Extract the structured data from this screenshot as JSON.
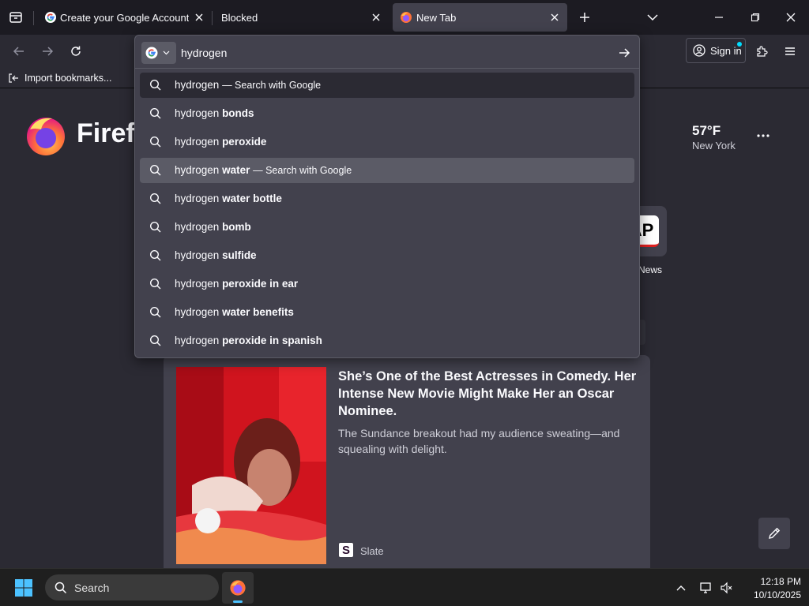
{
  "tabs": [
    {
      "label": "Create your Google Account",
      "icon": "google-icon"
    },
    {
      "label": "Blocked",
      "icon": ""
    },
    {
      "label": "New Tab",
      "icon": "firefox-icon"
    }
  ],
  "toolbar": {
    "sign_in": "Sign in",
    "import_bookmarks": "Import bookmarks..."
  },
  "urlbar": {
    "value": "hydrogen ",
    "engine_icon": "google-icon"
  },
  "suggestions": [
    {
      "base": "hydrogen",
      "bold": "",
      "hint": "— Search with Google"
    },
    {
      "base": "hydrogen",
      "bold": "bonds",
      "hint": ""
    },
    {
      "base": "hydrogen",
      "bold": "peroxide",
      "hint": ""
    },
    {
      "base": "hydrogen",
      "bold": "water",
      "hint": "— Search with Google"
    },
    {
      "base": "hydrogen",
      "bold": "water bottle",
      "hint": ""
    },
    {
      "base": "hydrogen",
      "bold": "bomb",
      "hint": ""
    },
    {
      "base": "hydrogen",
      "bold": "sulfide",
      "hint": ""
    },
    {
      "base": "hydrogen",
      "bold": "peroxide in ear",
      "hint": ""
    },
    {
      "base": "hydrogen",
      "bold": "water benefits",
      "hint": ""
    },
    {
      "base": "hydrogen",
      "bold": "peroxide in spanish",
      "hint": ""
    }
  ],
  "newtab": {
    "brand": "Firefox",
    "weather_temp": "57°F",
    "weather_city": "New York",
    "shortcut_label": "News",
    "shortcut_tile_text": "AP"
  },
  "story": {
    "title": "She’s One of the Best Actresses in Comedy. Her Intense New Movie Might Make Her an Oscar Nominee.",
    "excerpt": "The Sundance breakout had my audience sweating—and squealing with delight.",
    "source": "Slate",
    "source_logo_letter": "S"
  },
  "taskbar": {
    "search_label": "Search",
    "time": "12:18 PM",
    "date": "10/10/2025"
  },
  "colors": {
    "accent_blue": "#00ddff",
    "highlight_row": "#5b5b66"
  }
}
